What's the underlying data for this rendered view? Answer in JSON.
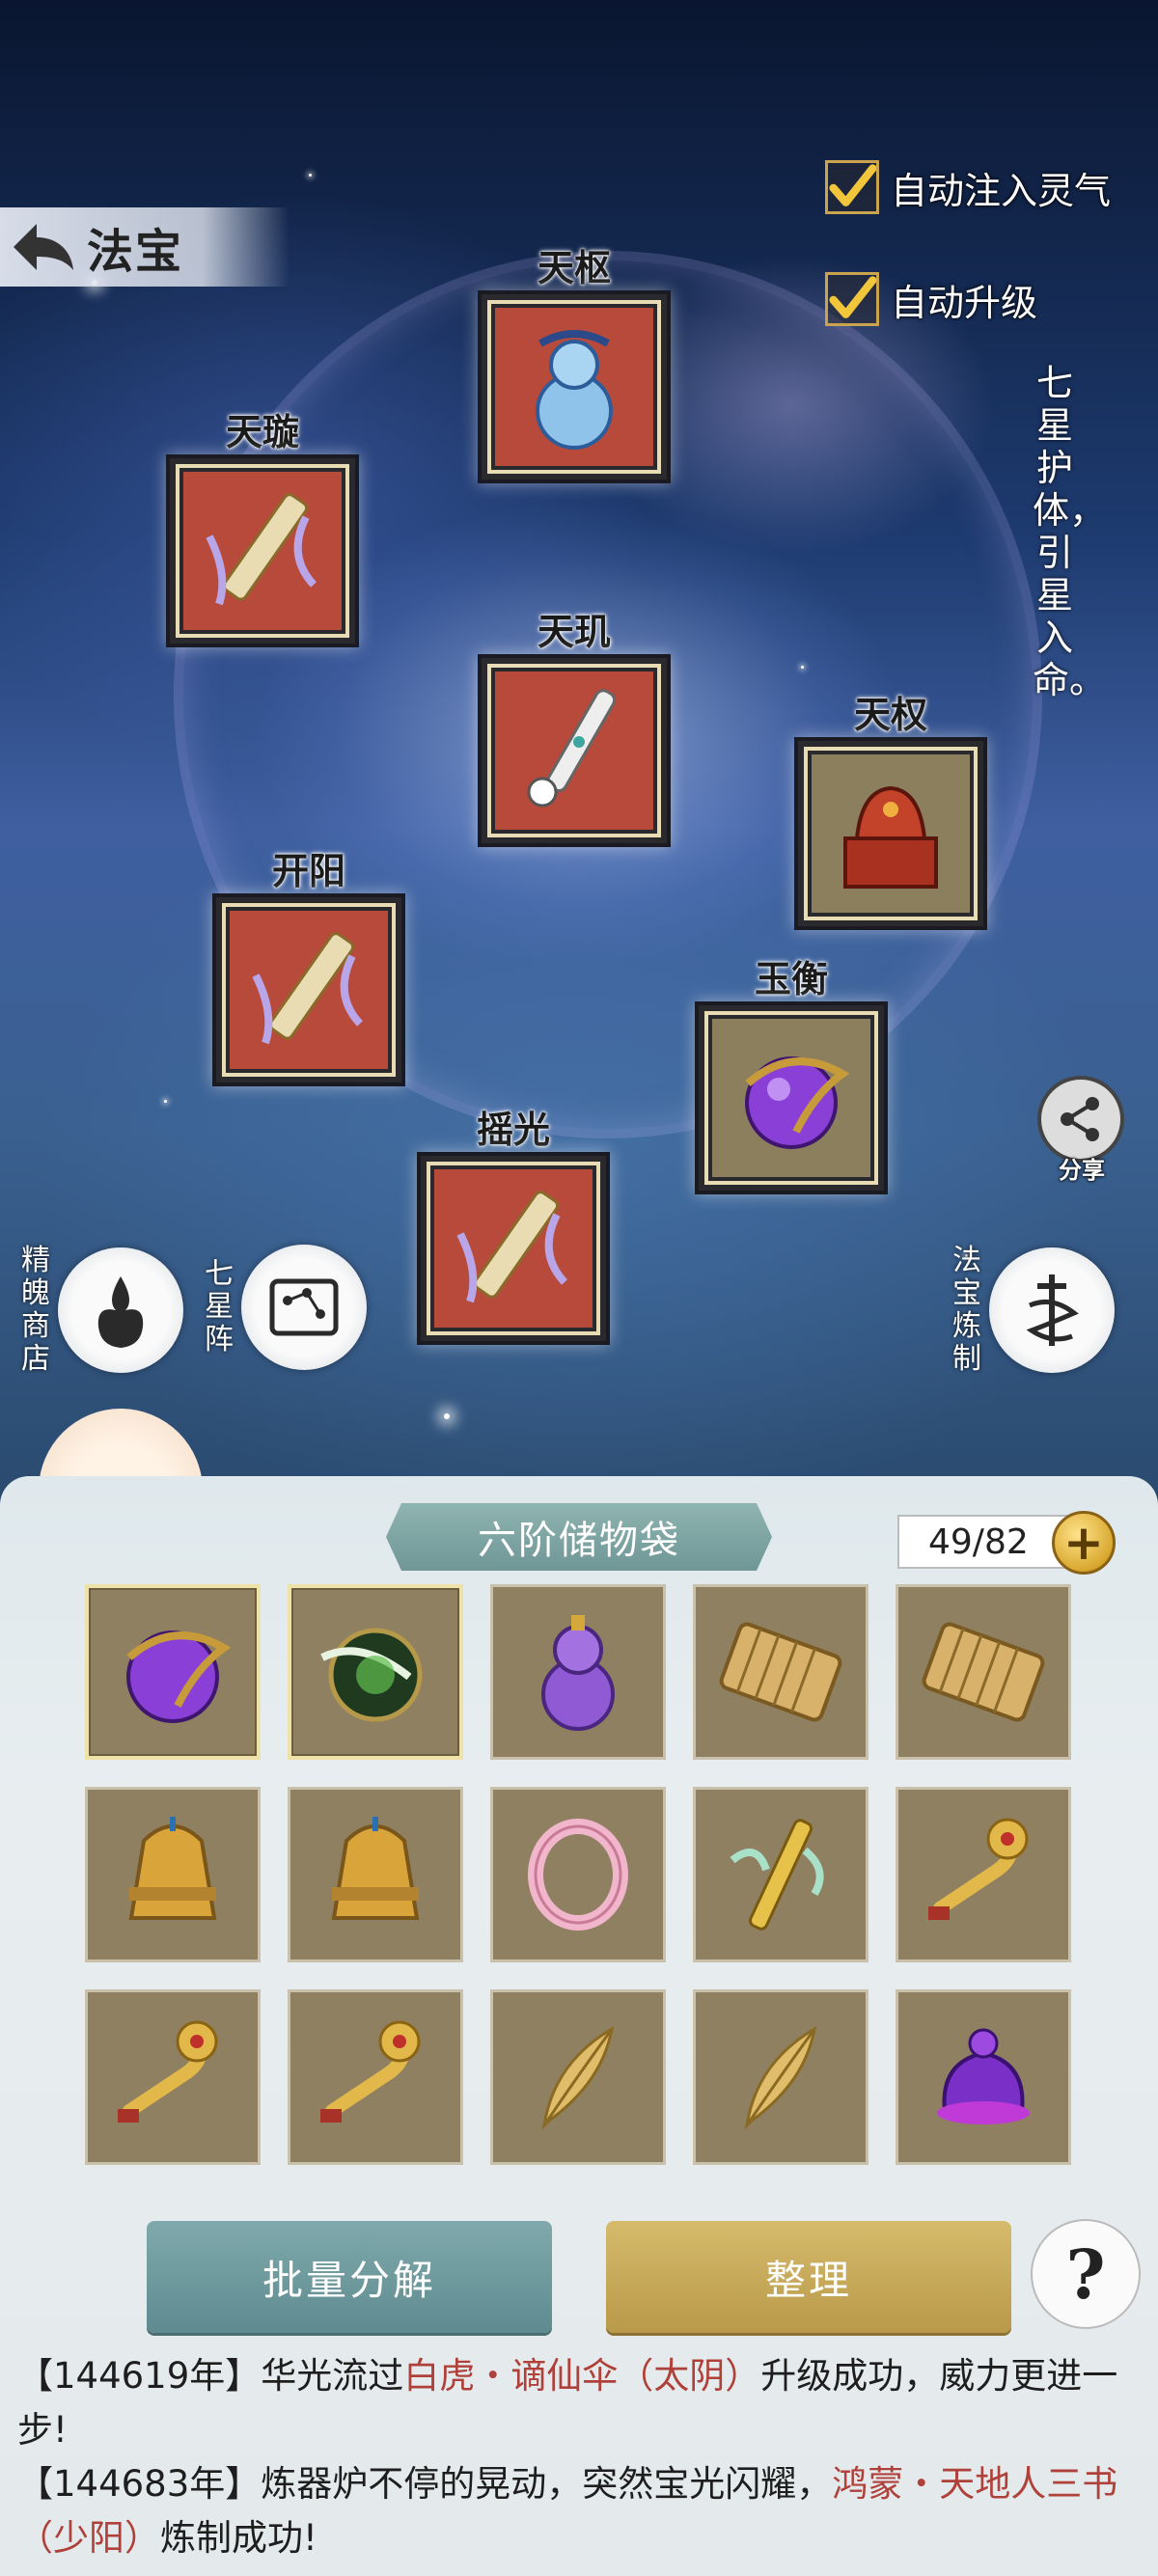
{
  "header": {
    "title": "法宝",
    "auto_inject_label": "自动注入灵气",
    "auto_upgrade_label": "自动升级",
    "side_slogan": "七星护体，引星入命。"
  },
  "constellation": {
    "slots": [
      {
        "id": "tianshu",
        "name": "天枢",
        "icon": "blue-gourd-icon"
      },
      {
        "id": "tianxuan",
        "name": "天璇",
        "icon": "scroll-icon"
      },
      {
        "id": "tianji",
        "name": "天玑",
        "icon": "white-brush-icon"
      },
      {
        "id": "tianquan",
        "name": "天权",
        "icon": "red-seal-icon"
      },
      {
        "id": "kaiyang",
        "name": "开阳",
        "icon": "scroll-icon"
      },
      {
        "id": "yuheng",
        "name": "玉衡",
        "icon": "purple-orb-icon"
      },
      {
        "id": "yaoguang",
        "name": "摇光",
        "icon": "scroll-icon"
      }
    ]
  },
  "side_buttons": {
    "shop": "精魄商店",
    "formation": "七星阵",
    "refine": "法宝炼制",
    "share": "分享"
  },
  "bag": {
    "title": "六阶储物袋",
    "capacity": "49/82",
    "add_symbol": "+",
    "items": [
      {
        "icon": "purple-orb-icon",
        "selected": true
      },
      {
        "icon": "green-orb-icon",
        "selected": true
      },
      {
        "icon": "purple-gourd-icon",
        "selected": false
      },
      {
        "icon": "bamboo-scroll-icon",
        "selected": false
      },
      {
        "icon": "bamboo-scroll-icon",
        "selected": false
      },
      {
        "icon": "golden-bell-icon",
        "selected": false
      },
      {
        "icon": "golden-bell-icon",
        "selected": false
      },
      {
        "icon": "pink-ring-icon",
        "selected": false
      },
      {
        "icon": "jade-scepter-icon",
        "selected": false
      },
      {
        "icon": "ruyi-icon",
        "selected": false
      },
      {
        "icon": "ruyi-icon",
        "selected": false
      },
      {
        "icon": "ruyi-icon",
        "selected": false
      },
      {
        "icon": "golden-feather-icon",
        "selected": false
      },
      {
        "icon": "golden-feather-icon",
        "selected": false
      },
      {
        "icon": "purple-lamp-icon",
        "selected": false
      }
    ]
  },
  "actions": {
    "batch_decompose": "批量分解",
    "sort": "整理",
    "help": "?"
  },
  "log": [
    {
      "prefix": "【144619年】华光流过",
      "highlight": "白虎・谪仙伞（太阴）",
      "suffix": "升级成功，威力更进一步!"
    },
    {
      "prefix": "【144683年】炼器炉不停的晃动，突然宝光闪耀，",
      "highlight": "鸿蒙・天地人三书（少阳）",
      "suffix": "炼制成功!"
    }
  ],
  "colors": {
    "slot_red": "#b84a3c",
    "highlight_red": "#b0403a",
    "gold": "#d9a930",
    "teal_button": "#6f9795"
  }
}
